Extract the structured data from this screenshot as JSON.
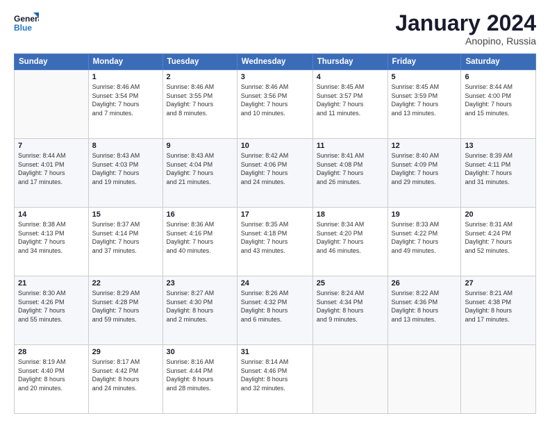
{
  "header": {
    "logo_line1": "General",
    "logo_line2": "Blue",
    "month": "January 2024",
    "location": "Anopino, Russia"
  },
  "weekdays": [
    "Sunday",
    "Monday",
    "Tuesday",
    "Wednesday",
    "Thursday",
    "Friday",
    "Saturday"
  ],
  "weeks": [
    [
      {
        "day": "",
        "info": ""
      },
      {
        "day": "1",
        "info": "Sunrise: 8:46 AM\nSunset: 3:54 PM\nDaylight: 7 hours\nand 7 minutes."
      },
      {
        "day": "2",
        "info": "Sunrise: 8:46 AM\nSunset: 3:55 PM\nDaylight: 7 hours\nand 8 minutes."
      },
      {
        "day": "3",
        "info": "Sunrise: 8:46 AM\nSunset: 3:56 PM\nDaylight: 7 hours\nand 10 minutes."
      },
      {
        "day": "4",
        "info": "Sunrise: 8:45 AM\nSunset: 3:57 PM\nDaylight: 7 hours\nand 11 minutes."
      },
      {
        "day": "5",
        "info": "Sunrise: 8:45 AM\nSunset: 3:59 PM\nDaylight: 7 hours\nand 13 minutes."
      },
      {
        "day": "6",
        "info": "Sunrise: 8:44 AM\nSunset: 4:00 PM\nDaylight: 7 hours\nand 15 minutes."
      }
    ],
    [
      {
        "day": "7",
        "info": "Sunrise: 8:44 AM\nSunset: 4:01 PM\nDaylight: 7 hours\nand 17 minutes."
      },
      {
        "day": "8",
        "info": "Sunrise: 8:43 AM\nSunset: 4:03 PM\nDaylight: 7 hours\nand 19 minutes."
      },
      {
        "day": "9",
        "info": "Sunrise: 8:43 AM\nSunset: 4:04 PM\nDaylight: 7 hours\nand 21 minutes."
      },
      {
        "day": "10",
        "info": "Sunrise: 8:42 AM\nSunset: 4:06 PM\nDaylight: 7 hours\nand 24 minutes."
      },
      {
        "day": "11",
        "info": "Sunrise: 8:41 AM\nSunset: 4:08 PM\nDaylight: 7 hours\nand 26 minutes."
      },
      {
        "day": "12",
        "info": "Sunrise: 8:40 AM\nSunset: 4:09 PM\nDaylight: 7 hours\nand 29 minutes."
      },
      {
        "day": "13",
        "info": "Sunrise: 8:39 AM\nSunset: 4:11 PM\nDaylight: 7 hours\nand 31 minutes."
      }
    ],
    [
      {
        "day": "14",
        "info": "Sunrise: 8:38 AM\nSunset: 4:13 PM\nDaylight: 7 hours\nand 34 minutes."
      },
      {
        "day": "15",
        "info": "Sunrise: 8:37 AM\nSunset: 4:14 PM\nDaylight: 7 hours\nand 37 minutes."
      },
      {
        "day": "16",
        "info": "Sunrise: 8:36 AM\nSunset: 4:16 PM\nDaylight: 7 hours\nand 40 minutes."
      },
      {
        "day": "17",
        "info": "Sunrise: 8:35 AM\nSunset: 4:18 PM\nDaylight: 7 hours\nand 43 minutes."
      },
      {
        "day": "18",
        "info": "Sunrise: 8:34 AM\nSunset: 4:20 PM\nDaylight: 7 hours\nand 46 minutes."
      },
      {
        "day": "19",
        "info": "Sunrise: 8:33 AM\nSunset: 4:22 PM\nDaylight: 7 hours\nand 49 minutes."
      },
      {
        "day": "20",
        "info": "Sunrise: 8:31 AM\nSunset: 4:24 PM\nDaylight: 7 hours\nand 52 minutes."
      }
    ],
    [
      {
        "day": "21",
        "info": "Sunrise: 8:30 AM\nSunset: 4:26 PM\nDaylight: 7 hours\nand 55 minutes."
      },
      {
        "day": "22",
        "info": "Sunrise: 8:29 AM\nSunset: 4:28 PM\nDaylight: 7 hours\nand 59 minutes."
      },
      {
        "day": "23",
        "info": "Sunrise: 8:27 AM\nSunset: 4:30 PM\nDaylight: 8 hours\nand 2 minutes."
      },
      {
        "day": "24",
        "info": "Sunrise: 8:26 AM\nSunset: 4:32 PM\nDaylight: 8 hours\nand 6 minutes."
      },
      {
        "day": "25",
        "info": "Sunrise: 8:24 AM\nSunset: 4:34 PM\nDaylight: 8 hours\nand 9 minutes."
      },
      {
        "day": "26",
        "info": "Sunrise: 8:22 AM\nSunset: 4:36 PM\nDaylight: 8 hours\nand 13 minutes."
      },
      {
        "day": "27",
        "info": "Sunrise: 8:21 AM\nSunset: 4:38 PM\nDaylight: 8 hours\nand 17 minutes."
      }
    ],
    [
      {
        "day": "28",
        "info": "Sunrise: 8:19 AM\nSunset: 4:40 PM\nDaylight: 8 hours\nand 20 minutes."
      },
      {
        "day": "29",
        "info": "Sunrise: 8:17 AM\nSunset: 4:42 PM\nDaylight: 8 hours\nand 24 minutes."
      },
      {
        "day": "30",
        "info": "Sunrise: 8:16 AM\nSunset: 4:44 PM\nDaylight: 8 hours\nand 28 minutes."
      },
      {
        "day": "31",
        "info": "Sunrise: 8:14 AM\nSunset: 4:46 PM\nDaylight: 8 hours\nand 32 minutes."
      },
      {
        "day": "",
        "info": ""
      },
      {
        "day": "",
        "info": ""
      },
      {
        "day": "",
        "info": ""
      }
    ]
  ]
}
